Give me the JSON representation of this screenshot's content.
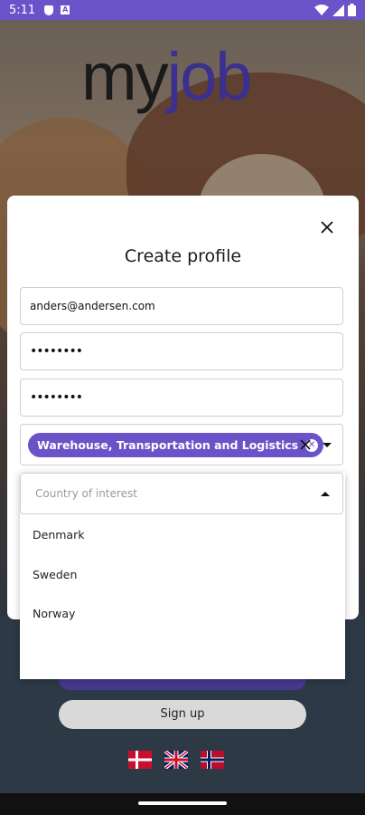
{
  "status_bar": {
    "time": "5:11",
    "icons": [
      "shield-icon",
      "a-icon",
      "wifi-icon",
      "signal-icon",
      "battery-icon"
    ]
  },
  "logo": {
    "part1": "my",
    "part2": "job"
  },
  "modal": {
    "title": "Create profile",
    "email_value": "anders@andersen.com",
    "password_value": "••••••••",
    "confirm_password_value": "••••••••",
    "category_chip": "Warehouse, Transportation and Logistics",
    "country_placeholder": "Country of interest",
    "country_options": [
      "Denmark",
      "Sweden",
      "Norway"
    ]
  },
  "signup_label": "Sign up",
  "language_flags": [
    "danish-flag-icon",
    "uk-flag-icon",
    "norwegian-flag-icon"
  ],
  "colors": {
    "accent": "#6a53c9",
    "logo_dark": "#1a1a1a",
    "logo_accent": "#3b2f8f",
    "modal_bg": "#ffffff"
  }
}
